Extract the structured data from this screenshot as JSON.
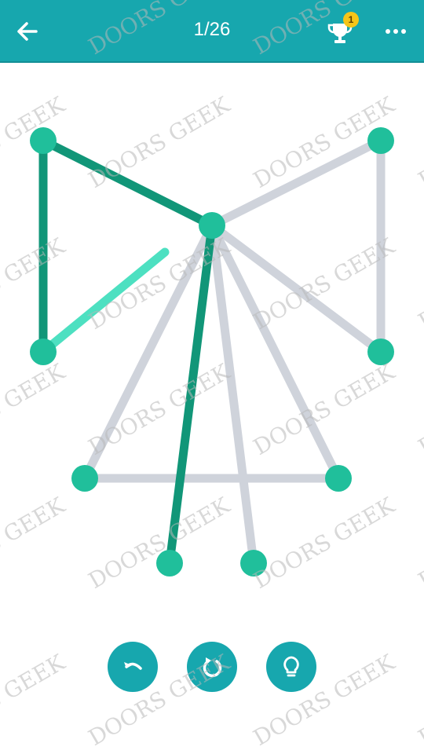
{
  "header": {
    "level": "1/26",
    "trophy_count": "1"
  },
  "watermark_text": "DOORS GEEK",
  "colors": {
    "header_bg": "#17a7ae",
    "node": "#20bf9b",
    "line_done": "#119678",
    "line_pending": "#cfd3db",
    "line_active": "#4de0c1"
  },
  "controls": {
    "undo_icon": "undo-icon",
    "restart_icon": "restart-icon",
    "hint_icon": "lightbulb-icon"
  }
}
